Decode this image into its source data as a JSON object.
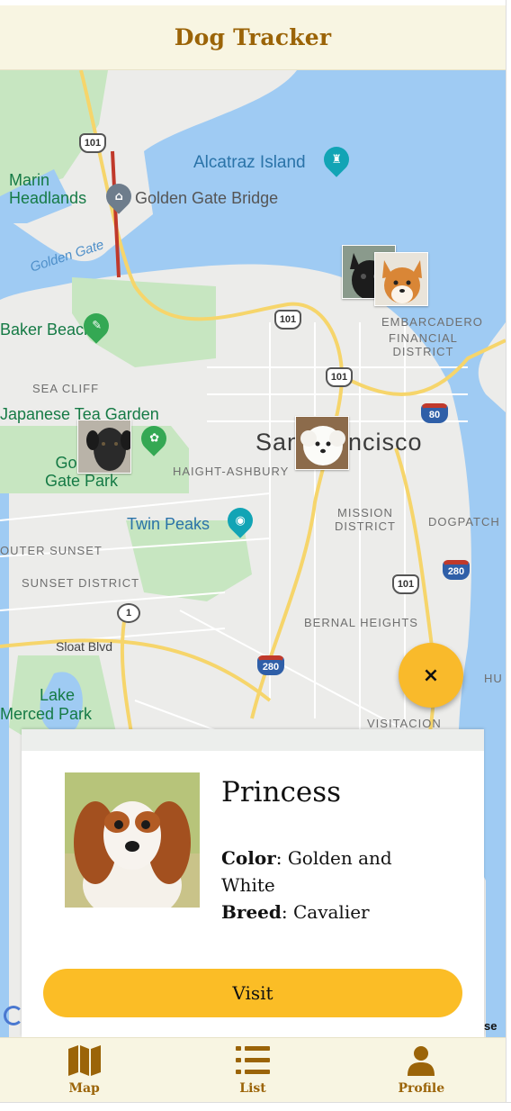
{
  "header": {
    "title": "Dog Tracker"
  },
  "map": {
    "labels": {
      "marin_headlands": "Marin\nHeadlands",
      "alcatraz": "Alcatraz Island",
      "golden_gate_bridge": "Golden Gate Bridge",
      "golden_gate": "Golden Gate",
      "baker_beach": "Baker Beach",
      "embarcadero": "EMBARCADERO",
      "financial_district": "FINANCIAL\nDISTRICT",
      "sea_cliff": "SEA CLIFF",
      "japanese_tea_garden": "Japanese Tea Garden",
      "san_francisco": "San Francisco",
      "gg_park": "Golden\nGate Park",
      "haight_ashbury": "HAIGHT-ASHBURY",
      "twin_peaks": "Twin Peaks",
      "mission_district": "MISSION\nDISTRICT",
      "dogpatch": "DOGPATCH",
      "outer_sunset": "OUTER SUNSET",
      "sunset_district": "SUNSET DISTRICT",
      "bernal_heights": "BERNAL HEIGHTS",
      "sloat_blvd": "Sloat Blvd",
      "lake_merced": "Lake\nMerced Park",
      "visitacion": "VISITACION",
      "hu": "HU"
    },
    "shields": [
      "101",
      "101",
      "101",
      "101",
      "80",
      "280",
      "101",
      "1",
      "280"
    ]
  },
  "fab": {
    "icon": "close-icon",
    "glyph": "×"
  },
  "card": {
    "name": "Princess",
    "color_label": "Color",
    "color_value": ": Golden and White",
    "breed_label": "Breed",
    "breed_value": ": Cavalier",
    "visit_label": "Visit"
  },
  "attribution": {
    "terms": "se"
  },
  "nav": {
    "map": "Map",
    "list": "List",
    "profile": "Profile"
  },
  "colors": {
    "accent": "#fbbd26",
    "brand_text": "#9b6408",
    "header_bg": "#f8f5e2",
    "water": "#9fcbf3",
    "park": "#c7e6c1"
  }
}
